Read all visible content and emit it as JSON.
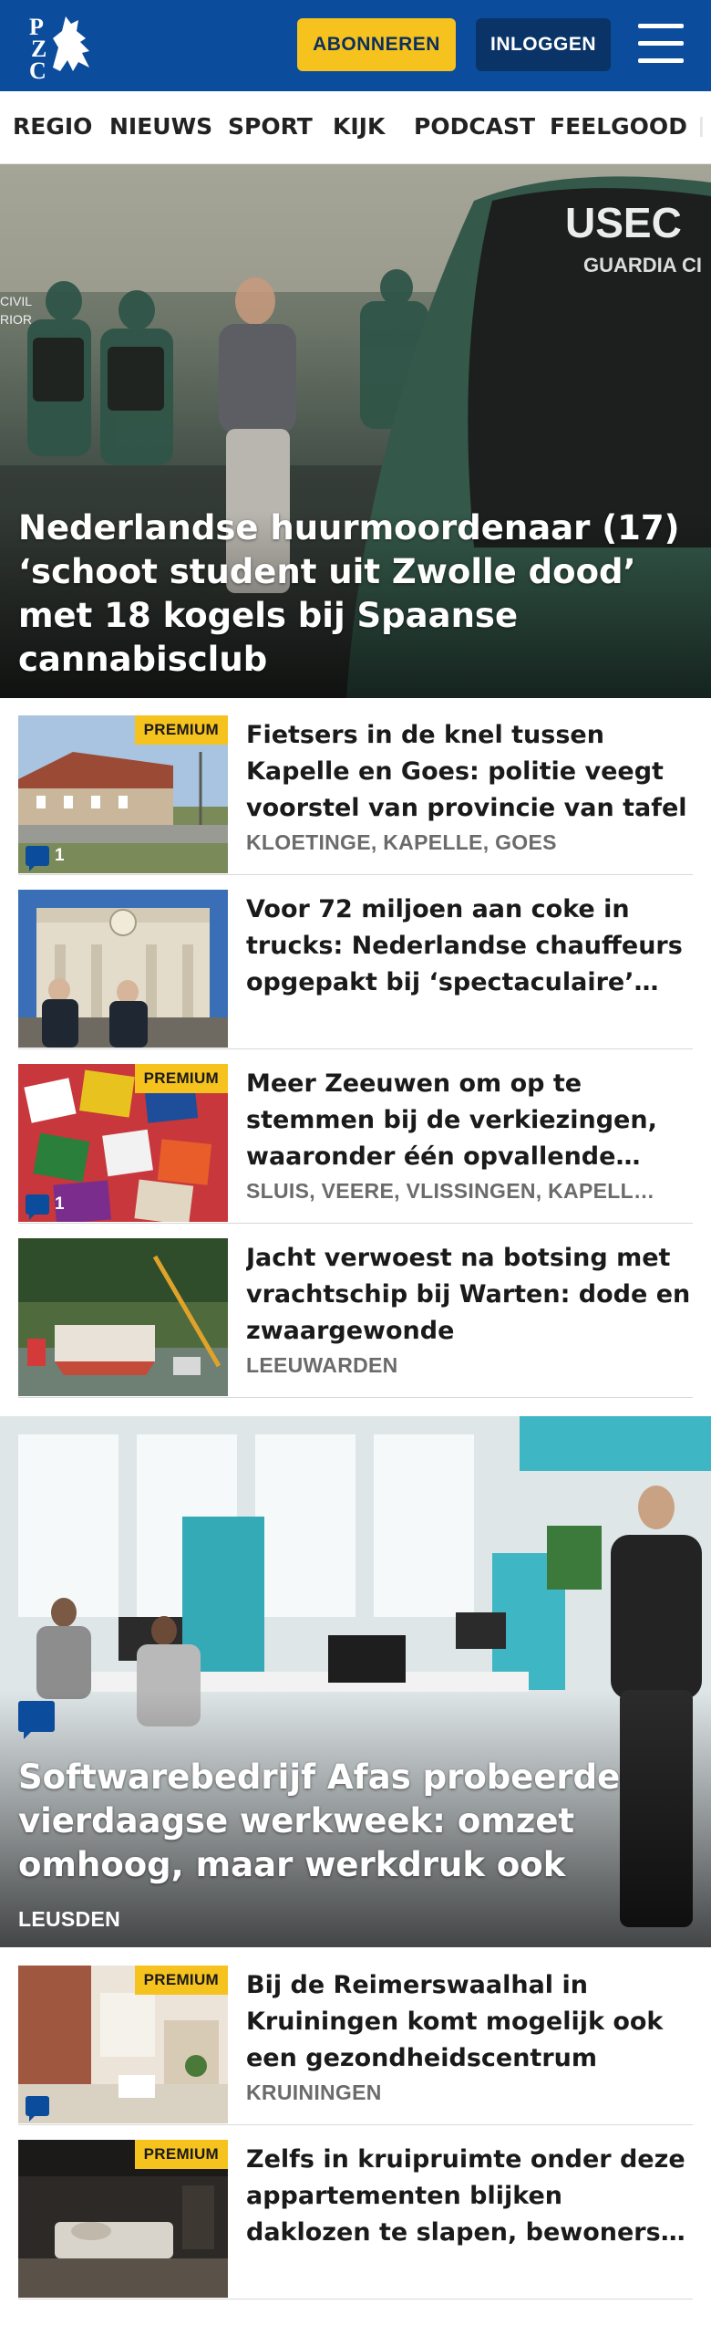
{
  "header": {
    "logo_text": "PZC",
    "subscribe_label": "ABONNEREN",
    "login_label": "INLOGGEN",
    "colors": {
      "brand": "#0b4d9c",
      "accent": "#f6c21d"
    }
  },
  "nav": {
    "items": [
      "REGIO",
      "NIEUWS",
      "SPORT",
      "KIJK",
      "PODCAST",
      "FEELGOOD"
    ]
  },
  "hero": {
    "title": "Nederlandse huurmoordenaar (17) ‘schoot student uit Zwolle dood’ met 18 kogels bij Spaanse cannabisclub",
    "image_text": {
      "vest": "USEC",
      "vest_sub": "GUARDIA CI",
      "badge_line1": "CIVIL",
      "badge_line2": "RIOR"
    }
  },
  "articles": [
    {
      "premium": "PREMIUM",
      "comments": "1",
      "title": "Fietsers in de knel tussen Kapelle en Goes: politie veegt voorstel van provincie van tafel",
      "location": "KLOETINGE, KAPELLE, GOES"
    },
    {
      "title": "Voor 72 miljoen aan coke in trucks: Nederlandse chauffeurs opgepakt bij ‘spectaculaire’…"
    },
    {
      "premium": "PREMIUM",
      "comments": "1",
      "title": "Meer Zeeuwen om op te stemmen bij de verkiezingen, waaronder één opvallende lijstduwer",
      "location": "SLUIS, VEERE, VLISSINGEN, KAPELL…"
    },
    {
      "title": "Jacht verwoest na botsing met vrachtschip bij Warten: dode en zwaargewonde",
      "location": "LEEUWARDEN"
    }
  ],
  "big_story": {
    "title": "Softwarebedrijf Afas probeerde vierdaagse werkweek: omzet omhoog, maar werkdruk ook",
    "location": "LEUSDEN"
  },
  "more_articles": [
    {
      "premium": "PREMIUM",
      "title": "Bij de Reimerswaalhal in Kruiningen komt mogelijk ook een gezondheidscentrum",
      "location": "KRUININGEN"
    },
    {
      "premium": "PREMIUM",
      "title": "Zelfs in kruipruimte onder deze appartementen blijken daklozen te slapen, bewoners zijn ten…"
    }
  ]
}
